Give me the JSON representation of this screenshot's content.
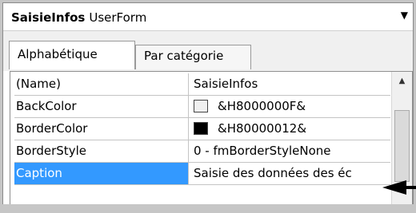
{
  "header": {
    "object_name": "SaisieInfos",
    "object_type": "UserForm"
  },
  "tabs": [
    {
      "label": "Alphabétique",
      "active": true
    },
    {
      "label": "Par catégorie",
      "active": false
    }
  ],
  "properties": [
    {
      "name": "(Name)",
      "value": "SaisieInfos"
    },
    {
      "name": "BackColor",
      "value": "&H8000000F&",
      "swatch": "#f0f0f0"
    },
    {
      "name": "BorderColor",
      "value": "&H80000012&",
      "swatch": "#000000"
    },
    {
      "name": "BorderStyle",
      "value": "0 - fmBorderStyleNone"
    },
    {
      "name": "Caption",
      "value": "Saisie des données des éc",
      "selected": true
    }
  ],
  "colors": {
    "selection": "#3399ff",
    "grid_line": "#c4c4c4",
    "tab_strip": "#f0f0f0",
    "background": "#c6c6c6"
  },
  "icons": {
    "dropdown": "chevron-down-icon",
    "scroll_up": "scroll-up-arrow-icon",
    "annotation": "arrow-pointer-icon"
  }
}
